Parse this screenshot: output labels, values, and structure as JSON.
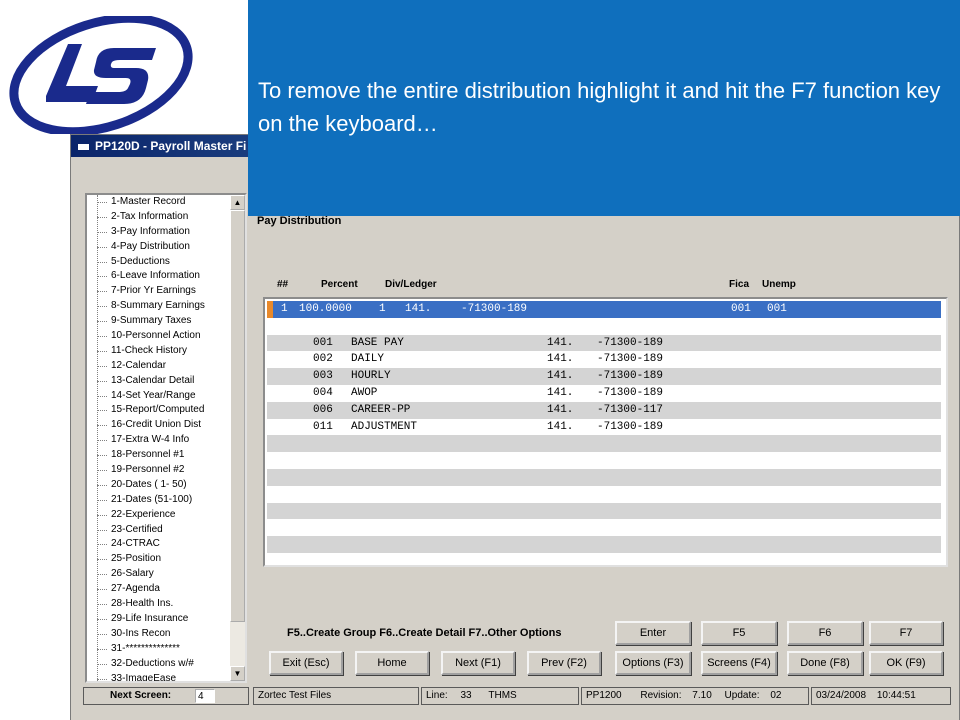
{
  "window": {
    "title": "PP120D - Payroll Master Fi"
  },
  "callout": {
    "text": "To remove the entire distribution highlight it and hit the F7 function key on the keyboard…"
  },
  "tree": {
    "items": [
      "1-Master Record",
      "2-Tax Information",
      "3-Pay Information",
      "4-Pay Distribution",
      "5-Deductions",
      "6-Leave Information",
      "7-Prior Yr Earnings",
      "8-Summary Earnings",
      "9-Summary Taxes",
      "10-Personnel Action",
      "11-Check History",
      "12-Calendar",
      "13-Calendar Detail",
      "14-Set Year/Range",
      "15-Report/Computed",
      "16-Credit Union Dist",
      "17-Extra W-4 Info",
      "18-Personnel #1",
      "19-Personnel #2",
      "20-Dates ( 1- 50)",
      "21-Dates (51-100)",
      "22-Experience",
      "23-Certified",
      "24-CTRAC",
      "25-Position",
      "26-Salary",
      "27-Agenda",
      "28-Health Ins.",
      "29-Life Insurance",
      "30-Ins Recon",
      "31-**************",
      "32-Deductions w/#",
      "33-ImageEase"
    ],
    "scroll_up": "▲",
    "scroll_down": "▼"
  },
  "content": {
    "section_label": "Pay Distribution",
    "columns": {
      "num": "##",
      "percent": "Percent",
      "divledger": "Div/Ledger",
      "fica": "Fica",
      "unemp": "Unemp"
    },
    "selected_row": {
      "num": "1",
      "percent": "100.0000",
      "div": "1",
      "ledger": "141.",
      "acct": "-71300-189",
      "fica": "001",
      "unemp": "001"
    },
    "detail_rows": [
      {
        "code": "001",
        "desc": "BASE PAY",
        "ledger": "141.",
        "acct": "-71300-189"
      },
      {
        "code": "002",
        "desc": "DAILY",
        "ledger": "141.",
        "acct": "-71300-189"
      },
      {
        "code": "003",
        "desc": "HOURLY",
        "ledger": "141.",
        "acct": "-71300-189"
      },
      {
        "code": "004",
        "desc": "AWOP",
        "ledger": "141.",
        "acct": "-71300-189"
      },
      {
        "code": "006",
        "desc": "CAREER-PP",
        "ledger": "141.",
        "acct": "-71300-117"
      },
      {
        "code": "011",
        "desc": "ADJUSTMENT",
        "ledger": "141.",
        "acct": "-71300-189"
      }
    ]
  },
  "function_keys_text": "F5..Create Group  F6..Create Detail  F7..Other Options",
  "buttons": {
    "enter": "Enter",
    "f5": "F5",
    "f6": "F6",
    "f7": "F7",
    "exit": "Exit (Esc)",
    "home": "Home",
    "next": "Next (F1)",
    "prev": "Prev (F2)",
    "options": "Options (F3)",
    "screens": "Screens (F4)",
    "done": "Done (F8)",
    "ok": "OK (F9)"
  },
  "status": {
    "next_screen_label": "Next Screen:",
    "next_screen_value": "4",
    "database": "Zortec Test Files",
    "line_label": "Line:",
    "line_value": "33",
    "user": "THMS",
    "program": "PP1200",
    "revision_label": "Revision:",
    "revision_value": "7.10",
    "update_label": "Update:",
    "update_value": "02",
    "date": "03/24/2008",
    "time": "10:44:51"
  },
  "colors": {
    "callout": "#0f6fbd",
    "selection": "#3a6fc4",
    "selection_marker": "#e8892b",
    "logo": "#1a2a8c"
  }
}
